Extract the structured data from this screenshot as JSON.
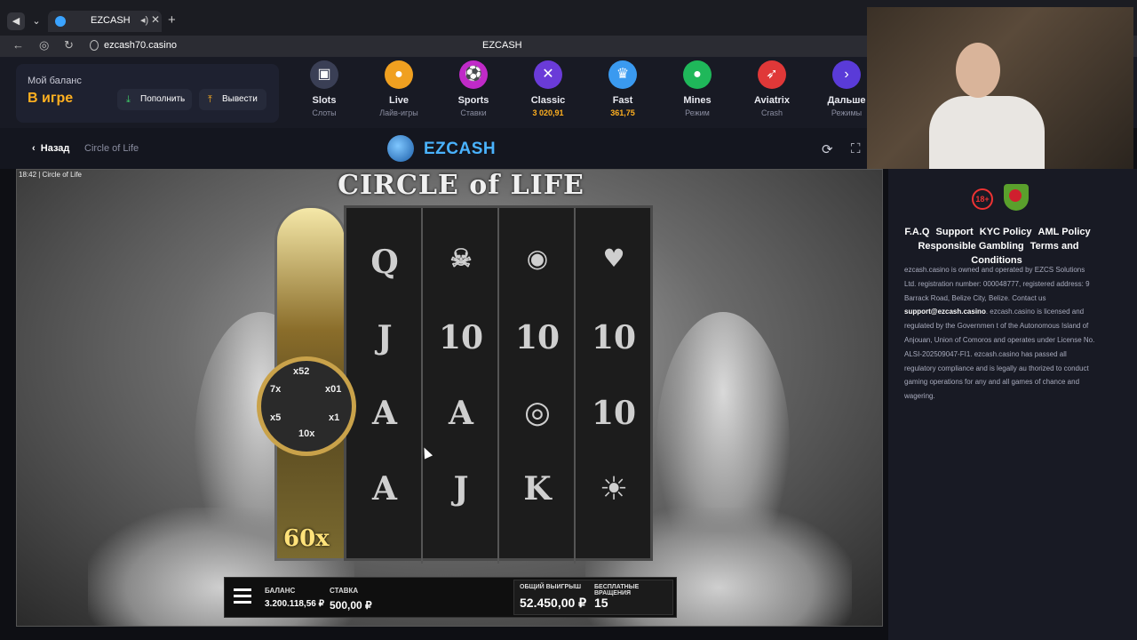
{
  "browser": {
    "tab_title": "EZCASH",
    "url": "ezcash70.casino",
    "center_title": "EZCASH"
  },
  "balance": {
    "label": "Мой баланс",
    "value": "В игре",
    "deposit_label": "Пополнить",
    "withdraw_label": "Вывести"
  },
  "categories": [
    {
      "name": "Slots",
      "sub": "Слоты",
      "color": "#3a3f55",
      "icon": "cards-icon"
    },
    {
      "name": "Live",
      "sub": "Лайв-игры",
      "color": "#f0a020",
      "icon": "person-icon"
    },
    {
      "name": "Sports",
      "sub": "Ставки",
      "color": "#c02ac8",
      "icon": "ball-icon"
    },
    {
      "name": "Classic",
      "sub": "3 020,91",
      "color": "#6a3bd8",
      "icon": "crossed-icon"
    },
    {
      "name": "Fast",
      "sub": "361,75",
      "color": "#3a9af0",
      "icon": "crown-icon"
    },
    {
      "name": "Mines",
      "sub": "Режим",
      "color": "#1fb85a",
      "icon": "bomb-icon"
    },
    {
      "name": "Aviatrix",
      "sub": "Crash",
      "color": "#e03838",
      "icon": "rocket-icon"
    },
    {
      "name": "Дальше",
      "sub": "Режимы",
      "color": "#5a3bd8",
      "icon": "chevron-right-icon"
    }
  ],
  "game_bar": {
    "back_label": "Назад",
    "crumb": "Circle of Life",
    "logo_text": "EZCASH"
  },
  "game": {
    "tag": "18:42 | Circle of Life",
    "title": "CIRCLE of LIFE",
    "multiplier": "60x",
    "wheel": [
      "x52",
      "x01",
      "x1",
      "10x",
      "x5",
      "7x"
    ],
    "reels": [
      [
        "Q",
        "J",
        "A",
        "A"
      ],
      [
        "",
        "10",
        "A",
        "J"
      ],
      [
        "",
        "10",
        "",
        "K"
      ],
      [
        "",
        "10",
        "10",
        ""
      ]
    ],
    "hud": {
      "balance_label": "БАЛАНС",
      "balance_value": "3.200.118,56 ₽",
      "bet_label": "СТАВКА",
      "bet_value": "500,00 ₽",
      "win_label": "ОБЩИЙ ВЫИГРЫШ",
      "win_value": "52.450,00 ₽",
      "free_label": "БЕСПЛАТНЫЕ ВРАЩЕНИЯ",
      "free_value": "15"
    }
  },
  "sidebar": {
    "age_badge": "18+",
    "links": [
      "F.A.Q",
      "Support",
      "KYC Policy",
      "AML Policy",
      "Responsible Gambling",
      "Terms and Conditions"
    ],
    "legal_1": "ezcash.casino is owned and operated by EZCS Solutions Ltd. registration number: 000048777, registered address: 9 Barrack Road, Belize City, Belize. Contact us ",
    "legal_email": "support@ezcash.casino",
    "legal_2": ". ezcash.casino is licensed and regulated by the Governmen t of the Autonomous Island of Anjouan, Union of Comoros and operates under License No. ALSI-202509047-FI1. ezcash.casino has passed all regulatory compliance and is legally au thorized to conduct gaming operations for any and all games of chance and wagering."
  }
}
